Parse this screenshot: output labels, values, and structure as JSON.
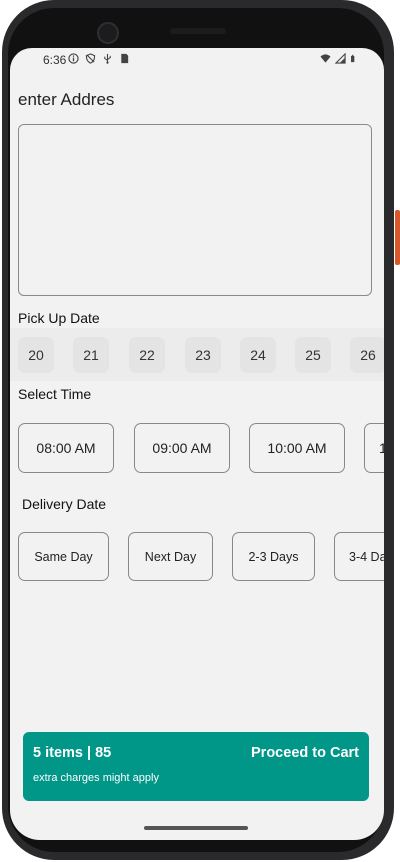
{
  "status_bar": {
    "time": "6:36",
    "left_icons": [
      "info-icon",
      "shield-icon",
      "usb-icon",
      "sim-card-icon"
    ],
    "right_icons": [
      "wifi-icon",
      "signal-icon",
      "battery-icon"
    ]
  },
  "address": {
    "label": "enter Addres",
    "value": ""
  },
  "pickup": {
    "label": "Pick Up Date",
    "dates": [
      "20",
      "21",
      "22",
      "23",
      "24",
      "25",
      "26"
    ]
  },
  "time": {
    "label": "Select Time",
    "slots": [
      "08:00 AM",
      "09:00 AM",
      "10:00 AM",
      "1"
    ]
  },
  "delivery": {
    "label": "Delivery Date",
    "options": [
      "Same Day",
      "Next Day",
      "2-3 Days",
      "3-4 Da"
    ]
  },
  "cart": {
    "summary": "5 items | 85",
    "note": "extra charges might apply",
    "proceed_label": "Proceed to Cart",
    "color": "#009688"
  }
}
